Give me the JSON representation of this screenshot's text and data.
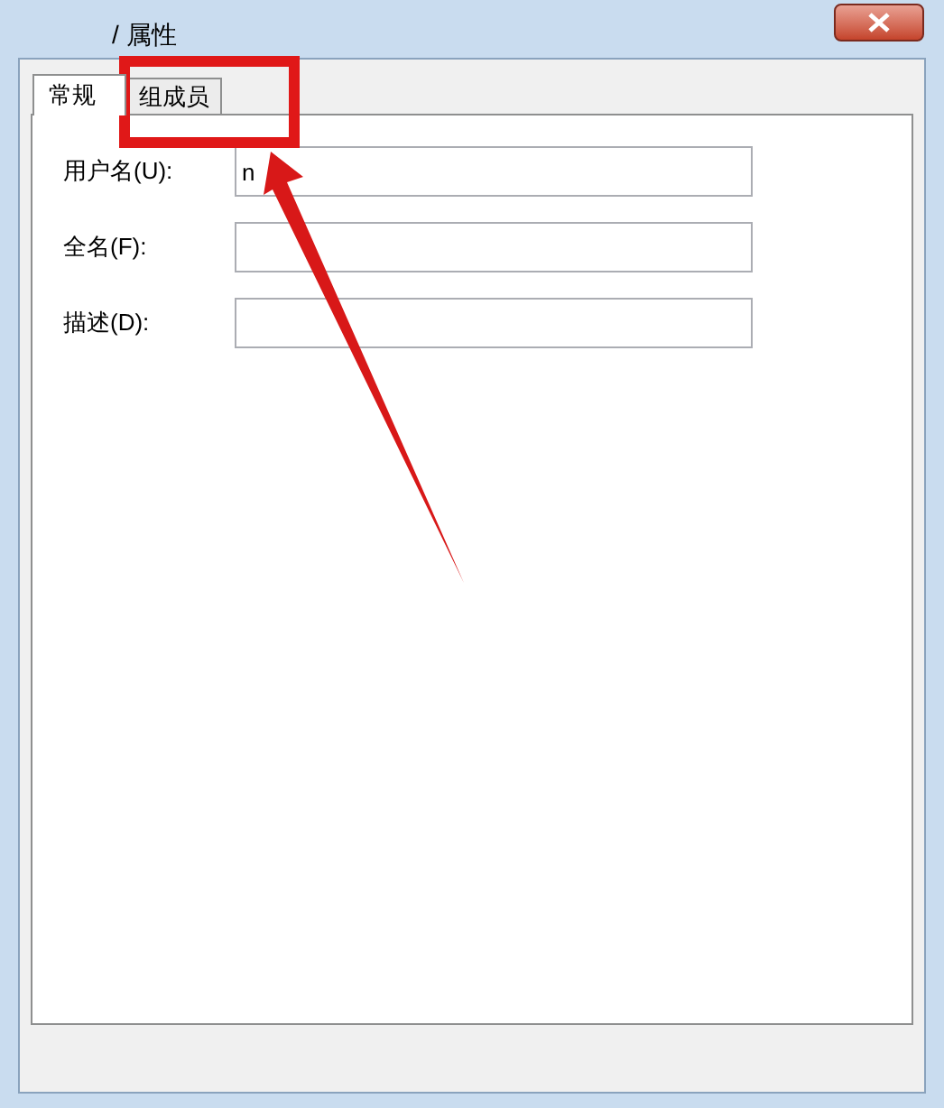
{
  "window": {
    "title": "/ 属性"
  },
  "tabs": [
    {
      "label": "常规",
      "selected": true
    },
    {
      "label": "组成员",
      "selected": false
    }
  ],
  "fields": [
    {
      "label": "用户名(U):",
      "value": "n"
    },
    {
      "label": "全名(F):"
    },
    {
      "label": "描述(D):"
    }
  ]
}
